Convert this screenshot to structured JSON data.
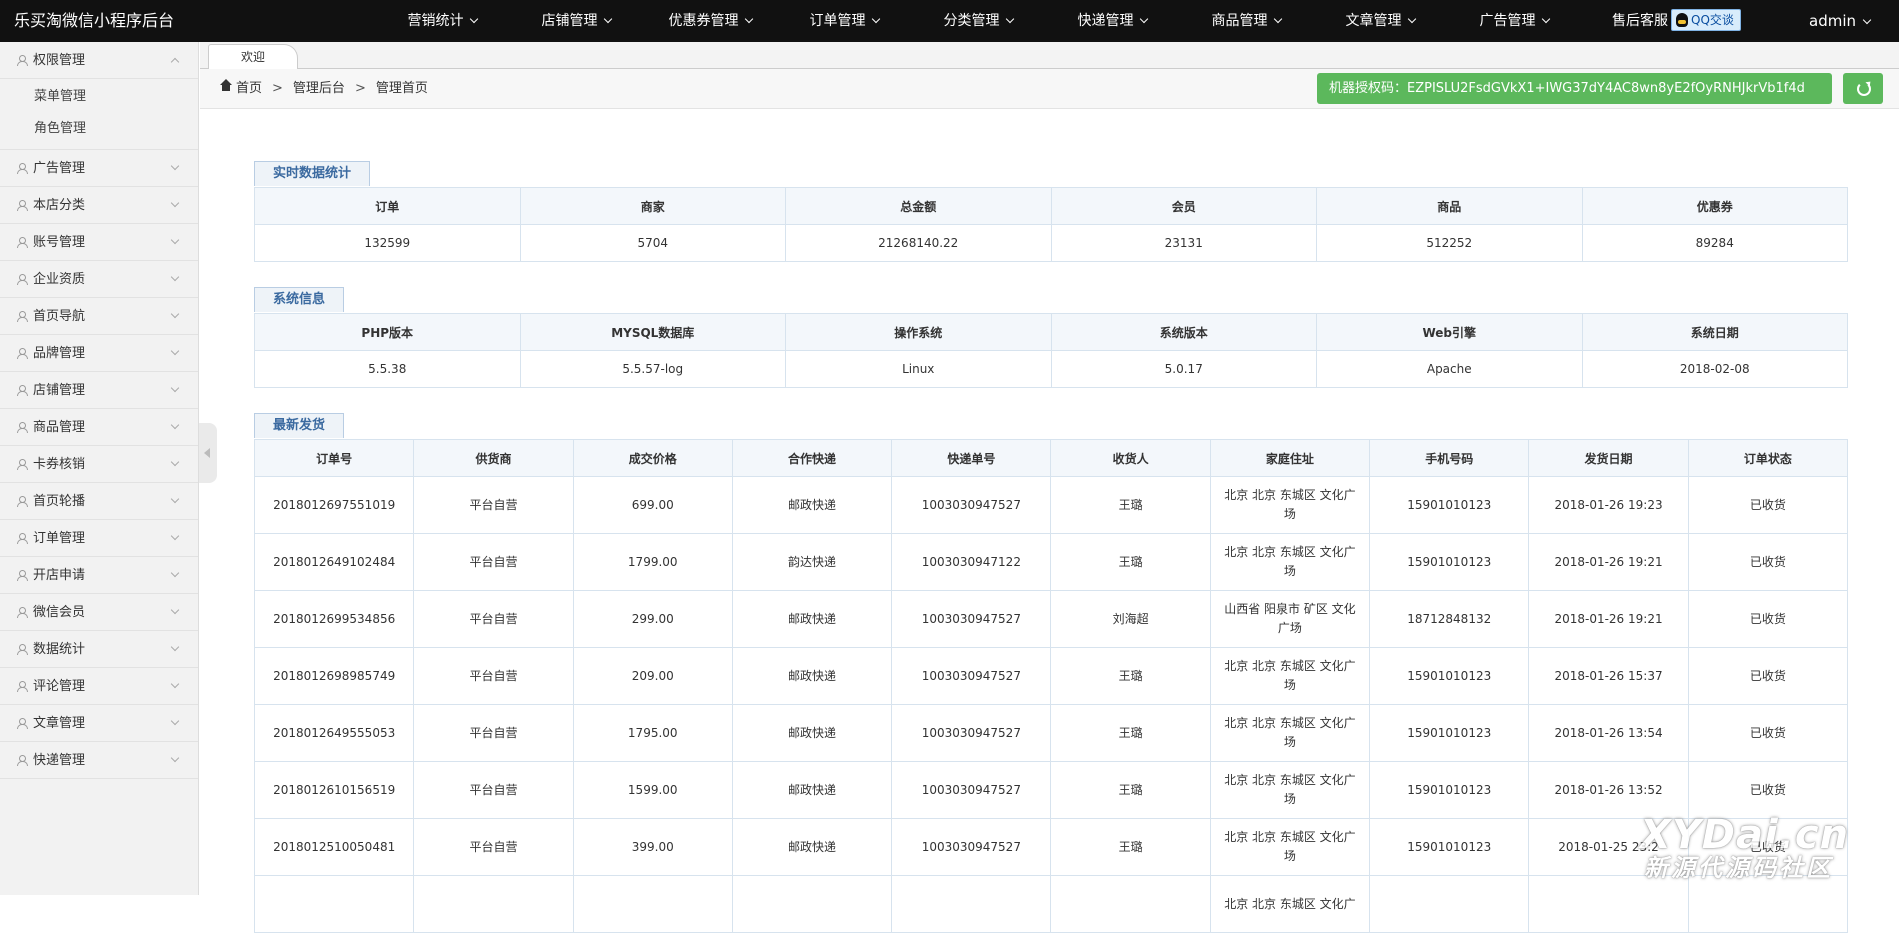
{
  "header": {
    "brand": "乐买淘微信小程序后台",
    "nav": [
      "营销统计",
      "店铺管理",
      "优惠券管理",
      "订单管理",
      "分类管理",
      "快递管理",
      "商品管理",
      "文章管理",
      "广告管理"
    ],
    "support_label": "售后客服",
    "qq_label": "QQ交谈",
    "user": "admin"
  },
  "sidebar": {
    "groups": [
      {
        "label": "权限管理",
        "children": [
          "菜单管理",
          "角色管理"
        ]
      },
      {
        "label": "广告管理"
      },
      {
        "label": "本店分类"
      },
      {
        "label": "账号管理"
      },
      {
        "label": "企业资质"
      },
      {
        "label": "首页导航"
      },
      {
        "label": "品牌管理"
      },
      {
        "label": "店铺管理"
      },
      {
        "label": "商品管理"
      },
      {
        "label": "卡券核销"
      },
      {
        "label": "首页轮播"
      },
      {
        "label": "订单管理"
      },
      {
        "label": "开店申请"
      },
      {
        "label": "微信会员"
      },
      {
        "label": "数据统计"
      },
      {
        "label": "评论管理"
      },
      {
        "label": "文章管理"
      },
      {
        "label": "快递管理"
      }
    ]
  },
  "tabs": {
    "active": "欢迎"
  },
  "breadcrumb": {
    "home": "首页",
    "level2": "管理后台",
    "level3": "管理首页"
  },
  "license": "机器授权码：EZPISLU2FsdGVkX1+IWG37dY4AC8wn8yE2fOyRNHJkrVb1f4d",
  "realtime": {
    "title": "实时数据统计",
    "headers": [
      "订单",
      "商家",
      "总金额",
      "会员",
      "商品",
      "优惠券"
    ],
    "values": [
      "132599",
      "5704",
      "21268140.22",
      "23131",
      "512252",
      "89284"
    ]
  },
  "system": {
    "title": "系统信息",
    "headers": [
      "PHP版本",
      "MYSQL数据库",
      "操作系统",
      "系统版本",
      "Web引擎",
      "系统日期"
    ],
    "values": [
      "5.5.38",
      "5.5.57-log",
      "Linux",
      "5.0.17",
      "Apache",
      "2018-02-08"
    ]
  },
  "shipments": {
    "title": "最新发货",
    "headers": [
      "订单号",
      "供货商",
      "成交价格",
      "合作快递",
      "快递单号",
      "收货人",
      "家庭住址",
      "手机号码",
      "发货日期",
      "订单状态"
    ],
    "rows": [
      [
        "2018012697551019",
        "平台自营",
        "699.00",
        "邮政快递",
        "1003030947527",
        "王璐",
        "北京 北京 东城区 文化广场",
        "15901010123",
        "2018-01-26 19:23",
        "已收货"
      ],
      [
        "2018012649102484",
        "平台自营",
        "1799.00",
        "韵达快递",
        "1003030947122",
        "王璐",
        "北京 北京 东城区 文化广场",
        "15901010123",
        "2018-01-26 19:21",
        "已收货"
      ],
      [
        "2018012699534856",
        "平台自营",
        "299.00",
        "邮政快递",
        "1003030947527",
        "刘海超",
        "山西省 阳泉市 矿区 文化广场",
        "18712848132",
        "2018-01-26 19:21",
        "已收货"
      ],
      [
        "2018012698985749",
        "平台自营",
        "209.00",
        "邮政快递",
        "1003030947527",
        "王璐",
        "北京 北京 东城区 文化广场",
        "15901010123",
        "2018-01-26 15:37",
        "已收货"
      ],
      [
        "2018012649555053",
        "平台自营",
        "1795.00",
        "邮政快递",
        "1003030947527",
        "王璐",
        "北京 北京 东城区 文化广场",
        "15901010123",
        "2018-01-26 13:54",
        "已收货"
      ],
      [
        "2018012610156519",
        "平台自营",
        "1599.00",
        "邮政快递",
        "1003030947527",
        "王璐",
        "北京 北京 东城区 文化广场",
        "15901010123",
        "2018-01-26 13:52",
        "已收货"
      ],
      [
        "2018012510050481",
        "平台自营",
        "399.00",
        "邮政快递",
        "1003030947527",
        "王璐",
        "北京 北京 东城区 文化广场",
        "15901010123",
        "2018-01-25 23:2",
        "已收货"
      ],
      [
        "",
        "",
        "",
        "",
        "",
        "",
        "北京 北京 东城区 文化广",
        "",
        "",
        ""
      ]
    ]
  },
  "watermark": {
    "line1": "XYDai.cn",
    "line2": "新源代源码社区"
  }
}
